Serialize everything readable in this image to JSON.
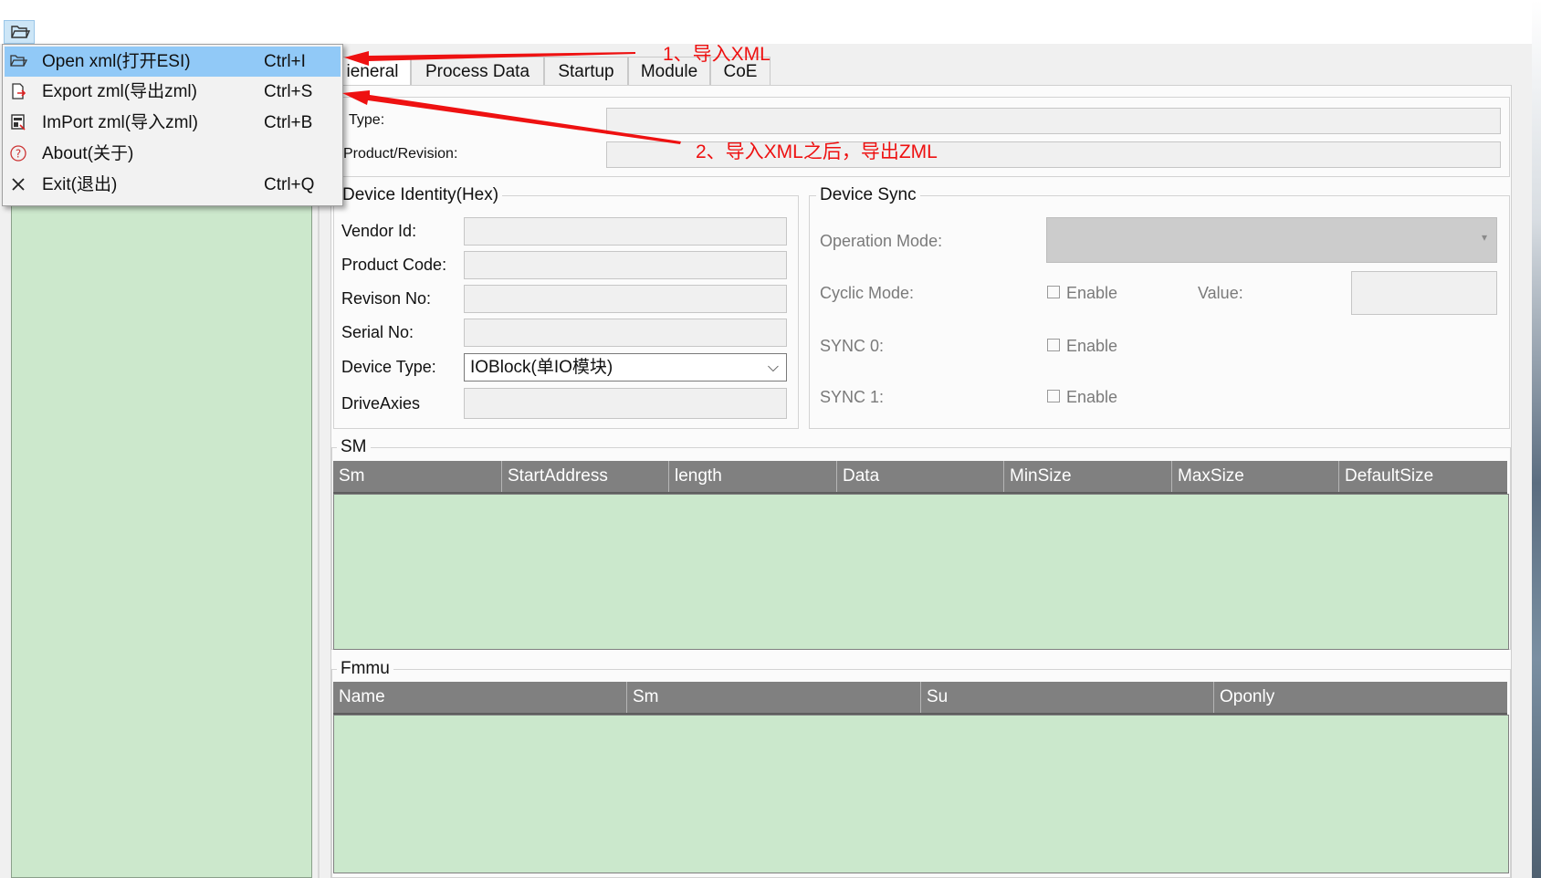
{
  "menu": {
    "items": [
      {
        "label": "Open xml(打开ESI)",
        "shortcut": "Ctrl+I",
        "icon": "folder-open-icon"
      },
      {
        "label": "Export zml(导出zml)",
        "shortcut": "Ctrl+S",
        "icon": "export-icon"
      },
      {
        "label": "ImPort zml(导入zml)",
        "shortcut": "Ctrl+B",
        "icon": "import-icon"
      },
      {
        "label": "About(关于)",
        "shortcut": "",
        "icon": "help-circle-icon"
      },
      {
        "label": "Exit(退出)",
        "shortcut": "Ctrl+Q",
        "icon": "close-icon"
      }
    ]
  },
  "tabs": [
    "ieneral",
    "Process Data",
    "Startup",
    "Module",
    "CoE"
  ],
  "general": {
    "type_label": "Type:",
    "product_revision_label": "Product/Revision:"
  },
  "identity": {
    "title": "Device Identity(Hex)",
    "vendor_id_label": "Vendor Id:",
    "product_code_label": "Product Code:",
    "revision_no_label": "Revison No:",
    "serial_no_label": "Serial No:",
    "device_type_label": "Device Type:",
    "device_type_value": "IOBlock(单IO模块)",
    "drive_axies_label": "DriveAxies"
  },
  "sync": {
    "title": "Device Sync",
    "operation_mode_label": "Operation Mode:",
    "cyclic_mode_label": "Cyclic Mode:",
    "value_label": "Value:",
    "sync0_label": "SYNC 0:",
    "sync1_label": "SYNC 1:",
    "enable_label": "Enable"
  },
  "sm": {
    "title": "SM",
    "columns": [
      "Sm",
      "StartAddress",
      "length",
      "Data",
      "MinSize",
      "MaxSize",
      "DefaultSize"
    ]
  },
  "fmmu": {
    "title": "Fmmu",
    "columns": [
      "Name",
      "Sm",
      "Su",
      "Oponly"
    ]
  },
  "annotations": {
    "note1": "1、导入XML",
    "note2": "2、导入XML之后，导出ZML"
  },
  "colors": {
    "highlight": "#91c9f7",
    "grid_header": "#808080",
    "grid_body": "#cbe8cc",
    "annotation": "#ee1111"
  }
}
